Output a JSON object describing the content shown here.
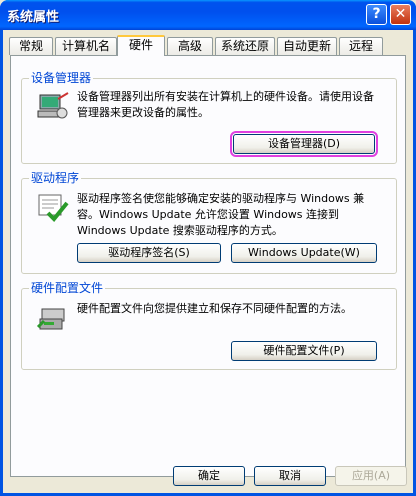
{
  "window": {
    "title": "系统属性",
    "help_label": "?",
    "close_label": "✕"
  },
  "tabs": [
    {
      "label": "常规"
    },
    {
      "label": "计算机名"
    },
    {
      "label": "硬件"
    },
    {
      "label": "高级"
    },
    {
      "label": "系统还原"
    },
    {
      "label": "自动更新"
    },
    {
      "label": "远程"
    }
  ],
  "active_tab": "硬件",
  "groups": {
    "device_manager": {
      "title": "设备管理器",
      "description": "设备管理器列出所有安装在计算机上的硬件设备。请使用设备管理器来更改设备的属性。",
      "button": "设备管理器(D)",
      "icon": "device-manager-icon"
    },
    "drivers": {
      "title": "驱动程序",
      "description": "驱动程序签名使您能够确定安装的驱动程序与 Windows 兼容。Windows Update 允许您设置 Windows 连接到 Windows Update 搜索驱动程序的方式。",
      "button_signing": "驱动程序签名(S)",
      "button_update": "Windows Update(W)",
      "icon": "driver-signing-icon"
    },
    "hardware_profiles": {
      "title": "硬件配置文件",
      "description": "硬件配置文件向您提供建立和保存不同硬件配置的方法。",
      "button": "硬件配置文件(P)",
      "icon": "hardware-profile-icon"
    }
  },
  "footer": {
    "ok": "确定",
    "cancel": "取消",
    "apply": "应用(A)"
  },
  "colors": {
    "title_bar": "#0054e3",
    "group_title": "#0046d5",
    "highlight": "#e040e0"
  }
}
